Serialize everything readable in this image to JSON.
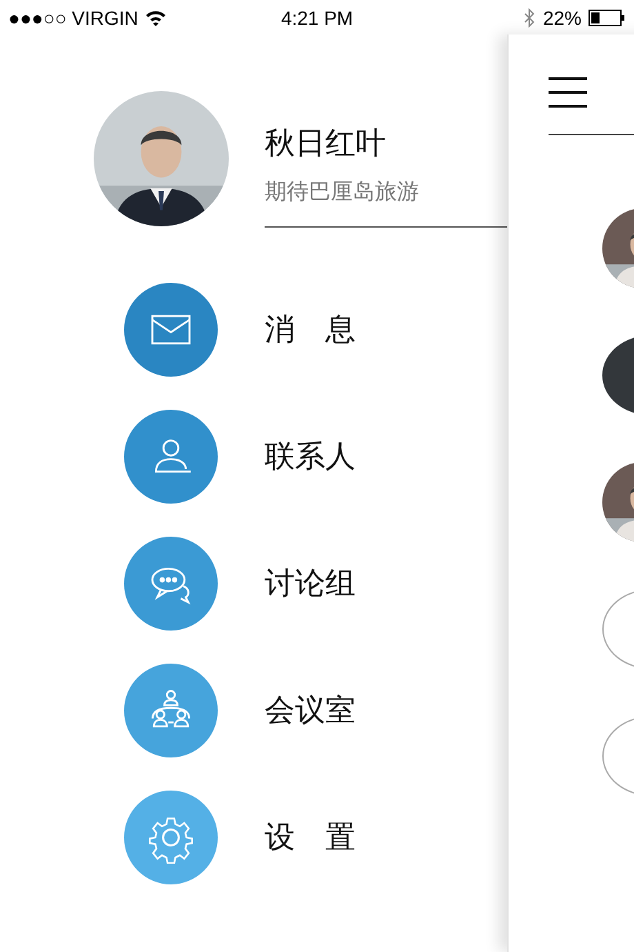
{
  "status_bar": {
    "carrier": "●●●○○ VIRGIN",
    "time": "4:21 PM",
    "battery": "22%"
  },
  "profile": {
    "avatar": {
      "kind": "picture"
    },
    "name": "秋日红叶",
    "motto": "期待巴厘岛旅游"
  },
  "menu": [
    {
      "kind": "mail",
      "label": "消　息",
      "color": "#2a86c2"
    },
    {
      "kind": "contact",
      "label": "联系人",
      "color": "#3190cc"
    },
    {
      "kind": "chat",
      "label": "讨论组",
      "color": "#3b9ad4"
    },
    {
      "kind": "meeting",
      "label": "会议室",
      "color": "#46a4dc"
    },
    {
      "kind": "settings",
      "label": "设　置",
      "color": "#54b0e6"
    }
  ],
  "behind_list": [
    {
      "kind": "picture"
    },
    {
      "kind": "dark"
    },
    {
      "kind": "picture"
    },
    {
      "kind": "outline"
    },
    {
      "kind": "outline"
    }
  ]
}
